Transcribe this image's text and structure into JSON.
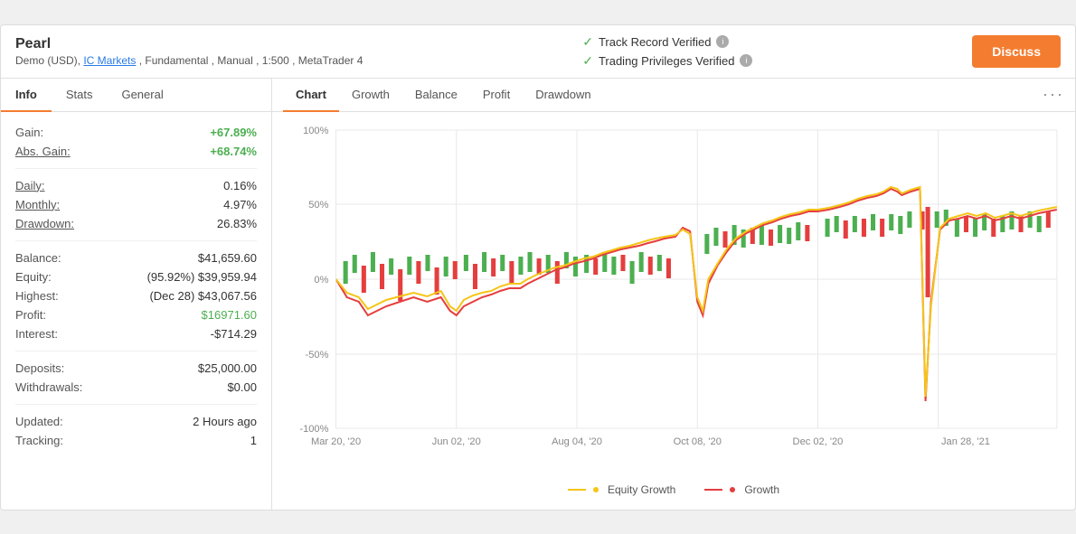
{
  "app": {
    "title": "Pearl",
    "subtitle": "Demo (USD), IC Markets , Fundamental , Manual , 1:500 , MetaTrader 4",
    "ic_markets_link": "IC Markets",
    "verified1": "Track Record Verified",
    "verified2": "Trading Privileges Verified",
    "discuss_label": "Discuss"
  },
  "left_tabs": [
    {
      "label": "Info",
      "active": true
    },
    {
      "label": "Stats",
      "active": false
    },
    {
      "label": "General",
      "active": false
    }
  ],
  "stats": {
    "gain_label": "Gain:",
    "gain_value": "+67.89%",
    "abs_gain_label": "Abs. Gain:",
    "abs_gain_value": "+68.74%",
    "daily_label": "Daily:",
    "daily_value": "0.16%",
    "monthly_label": "Monthly:",
    "monthly_value": "4.97%",
    "drawdown_label": "Drawdown:",
    "drawdown_value": "26.83%",
    "balance_label": "Balance:",
    "balance_value": "$41,659.60",
    "equity_label": "Equity:",
    "equity_value": "(95.92%) $39,959.94",
    "highest_label": "Highest:",
    "highest_value": "(Dec 28) $43,067.56",
    "profit_label": "Profit:",
    "profit_value": "$16971.60",
    "interest_label": "Interest:",
    "interest_value": "-$714.29",
    "deposits_label": "Deposits:",
    "deposits_value": "$25,000.00",
    "withdrawals_label": "Withdrawals:",
    "withdrawals_value": "$0.00",
    "updated_label": "Updated:",
    "updated_value": "2 Hours ago",
    "tracking_label": "Tracking:",
    "tracking_value": "1"
  },
  "chart_tabs": [
    {
      "label": "Chart",
      "active": true
    },
    {
      "label": "Growth",
      "active": false
    },
    {
      "label": "Balance",
      "active": false
    },
    {
      "label": "Profit",
      "active": false
    },
    {
      "label": "Drawdown",
      "active": false
    }
  ],
  "chart": {
    "x_labels": [
      "Mar 20, '20",
      "Jun 02, '20",
      "Aug 04, '20",
      "Oct 08, '20",
      "Dec 02, '20",
      "Jan 28, '21"
    ],
    "y_labels": [
      "100%",
      "50%",
      "0%",
      "-50%",
      "-100%"
    ],
    "legend": [
      {
        "label": "Equity Growth",
        "color": "#f5c518"
      },
      {
        "label": "Growth",
        "color": "#e53e3e"
      }
    ]
  }
}
